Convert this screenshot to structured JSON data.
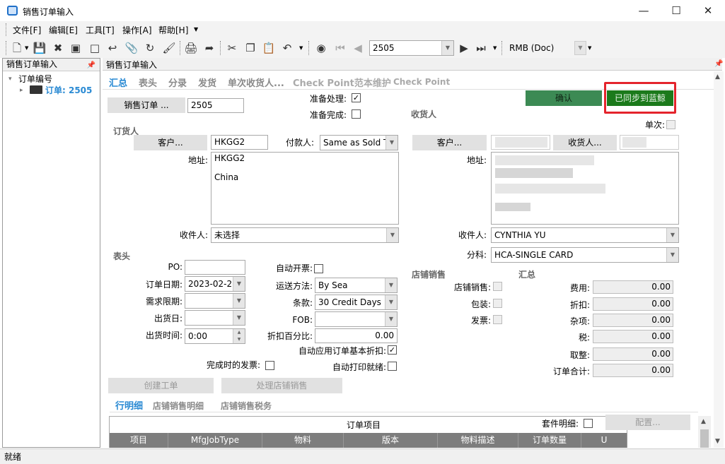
{
  "window": {
    "title": "销售订单输入"
  },
  "menu": [
    "文件[F]",
    "编辑[E]",
    "工具[T]",
    "操作[A]",
    "帮助[H]"
  ],
  "toolbar": {
    "order_value": "2505",
    "currency": "RMB (Doc)"
  },
  "left_panel": {
    "title": "销售订单输入",
    "tree_root": "订单编号",
    "tree_child": "订单: 2505"
  },
  "main_panel": {
    "title": "销售订单输入"
  },
  "tabs": [
    "汇总",
    "表头",
    "分录",
    "发货",
    "单次收货人...",
    "Check Point范本维护",
    "Check Point"
  ],
  "header": {
    "order_btn": "销售订单 ...",
    "order_no": "2505",
    "ready_process": "准备处理:",
    "ready_complete": "准备完成:",
    "confirm_btn": "确认",
    "synced_btn": "已同步到蓝鲸"
  },
  "soldto": {
    "section": "订货人",
    "customer_btn": "客户...",
    "customer_val": "HKGG2",
    "payer_lbl": "付款人:",
    "payer_val": "Same as Sold T",
    "addr_lbl": "地址:",
    "addr_line1": "HKGG2",
    "addr_line2": "China",
    "recv_lbl": "收件人:",
    "recv_val": "未选择"
  },
  "shipto": {
    "section": "收货人",
    "single_lbl": "单次:",
    "customer_btn": "客户...",
    "shipto_btn": "收货人...",
    "addr_lbl": "地址:",
    "recv_lbl": "收件人:",
    "recv_val": "CYNTHIA YU",
    "branch_lbl": "分科:",
    "branch_val": "HCA-SINGLE CARD"
  },
  "head": {
    "section": "表头",
    "po_lbl": "PO:",
    "orderdate_lbl": "订单日期:",
    "orderdate_val": "2023-02-2",
    "needdate_lbl": "需求限期:",
    "shipdate_lbl": "出货日:",
    "shiptime_lbl": "出货时间:",
    "shiptime_val": "0:00",
    "autoinv_lbl": "自动开票:",
    "shipvia_lbl": "运送方法:",
    "shipvia_val": "By Sea",
    "terms_lbl": "条款:",
    "terms_val": "30 Credit Days",
    "fob_lbl": "FOB:",
    "disc_lbl": "折扣百分比:",
    "disc_val": "0.00",
    "autoapply_lbl": "自动应用订单基本折扣:",
    "autoprint_lbl": "自动打印就绪:",
    "invcomplete_lbl": "完成时的发票:"
  },
  "store": {
    "section": "店铺销售",
    "store_lbl": "店铺销售:",
    "pack_lbl": "包装:",
    "inv_lbl": "发票:"
  },
  "summary": {
    "section": "汇总",
    "rows": [
      {
        "label": "费用:",
        "value": "0.00"
      },
      {
        "label": "折扣:",
        "value": "0.00"
      },
      {
        "label": "杂项:",
        "value": "0.00"
      },
      {
        "label": "税:",
        "value": "0.00"
      },
      {
        "label": "取整:",
        "value": "0.00"
      },
      {
        "label": "订单合计:",
        "value": "0.00"
      }
    ]
  },
  "actions": {
    "create_job": "创建工单",
    "process_store": "处理店铺销售"
  },
  "detail_tabs": [
    "行明细",
    "店铺销售明细",
    "店铺销售税务"
  ],
  "grid": {
    "title": "订单项目",
    "kit_lbl": "套件明细:",
    "config_btn": "配置...",
    "columns": [
      "项目",
      "MfgJobType",
      "物料",
      "版本",
      "物料描述",
      "订单数量",
      "U"
    ]
  },
  "status": "就绪"
}
